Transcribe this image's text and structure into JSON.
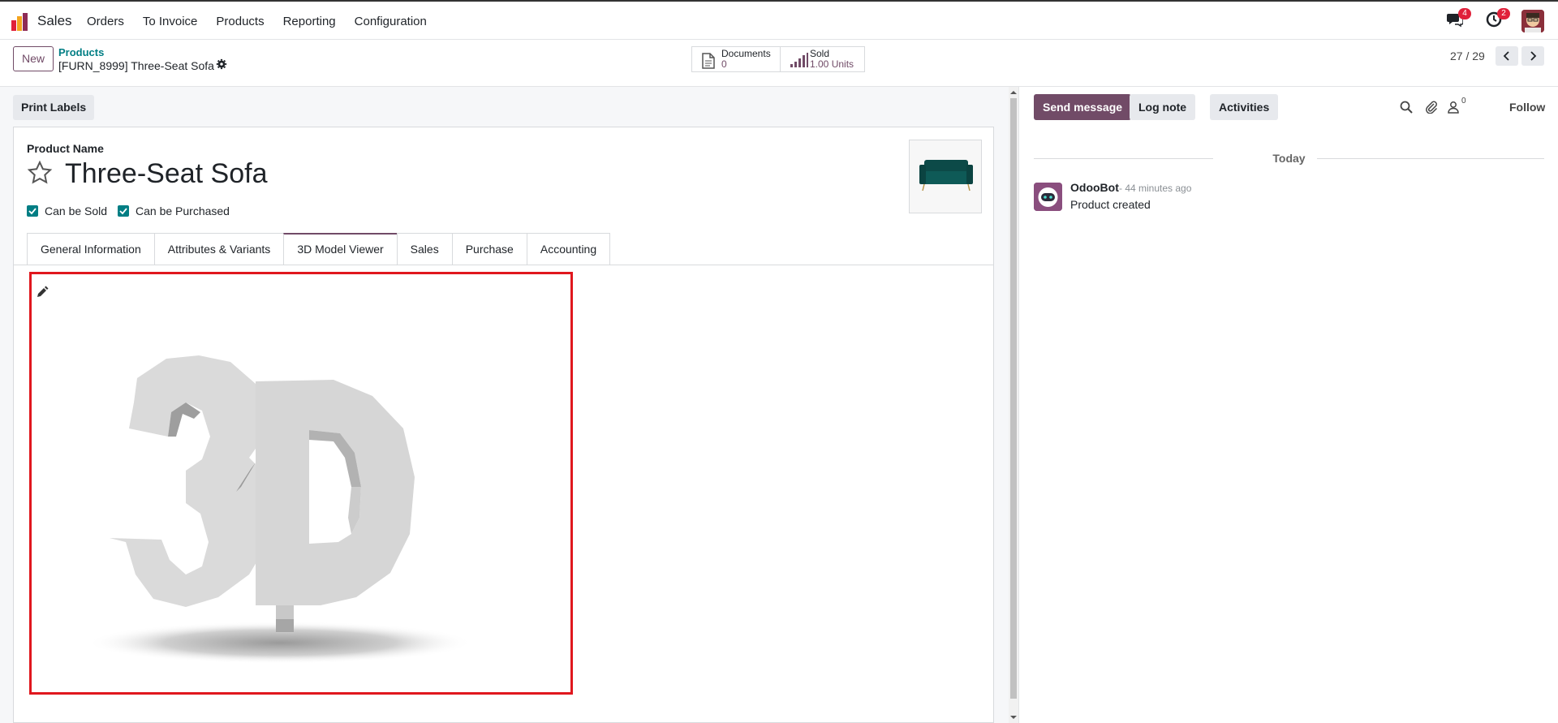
{
  "app": {
    "name": "Sales",
    "menu": [
      "Orders",
      "To Invoice",
      "Products",
      "Reporting",
      "Configuration"
    ],
    "systray": {
      "messages_count": "4",
      "activities_count": "2"
    }
  },
  "control_panel": {
    "new_label": "New",
    "breadcrumb_parent": "Products",
    "breadcrumb_current": "[FURN_8999] Three-Seat Sofa",
    "smart_buttons": [
      {
        "title": "Documents",
        "value": "0",
        "icon": "document-icon"
      },
      {
        "title": "Sold",
        "value": "1.00 Units",
        "icon": "chart-bars-icon"
      }
    ],
    "pager": "27 / 29"
  },
  "form": {
    "print_labels": "Print Labels",
    "product_name_label": "Product Name",
    "product_name": "Three-Seat Sofa",
    "can_be_sold_label": "Can be Sold",
    "can_be_sold": true,
    "can_be_purchased_label": "Can be Purchased",
    "can_be_purchased": true,
    "tabs": [
      "General Information",
      "Attributes & Variants",
      "3D Model Viewer",
      "Sales",
      "Purchase",
      "Accounting"
    ],
    "active_tab": "3D Model Viewer",
    "colors": {
      "brand": "#714b67",
      "teal": "#017e84",
      "highlight_border": "#e0171e"
    }
  },
  "chatter": {
    "send_message": "Send message",
    "log_note": "Log note",
    "activities": "Activities",
    "followers_count": "0",
    "follow": "Follow",
    "date_separator": "Today",
    "message": {
      "author": "OdooBot",
      "date": "- 44 minutes ago",
      "body": "Product created"
    }
  }
}
